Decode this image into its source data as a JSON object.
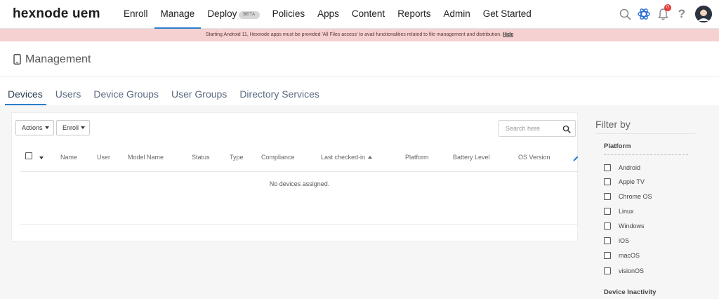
{
  "brand": {
    "logo_text": "hexnode uem"
  },
  "nav": {
    "items": [
      {
        "label": "Enroll"
      },
      {
        "label": "Manage",
        "active": true
      },
      {
        "label": "Deploy",
        "badge": "BETA"
      },
      {
        "label": "Policies"
      },
      {
        "label": "Apps"
      },
      {
        "label": "Content"
      },
      {
        "label": "Reports"
      },
      {
        "label": "Admin"
      },
      {
        "label": "Get Started"
      }
    ],
    "icons": [
      "search-icon",
      "integrations-icon",
      "notifications-icon",
      "help-icon",
      "user-avatar"
    ],
    "notification_count": "0",
    "help_label": "?"
  },
  "banner": {
    "message": "Starting Android 11, Hexnode apps must be provided  'All Files access'  to avail functionalities related to file management and distribution. ",
    "link": "Hide"
  },
  "page": {
    "title": "Management",
    "icon": "mobile-device-icon"
  },
  "tabs": [
    {
      "label": "Devices",
      "active": true
    },
    {
      "label": "Users"
    },
    {
      "label": "Device Groups"
    },
    {
      "label": "User Groups"
    },
    {
      "label": "Directory Services"
    }
  ],
  "toolbar": {
    "actions_label": "Actions",
    "enroll_label": "Enroll",
    "search_placeholder": "Search here"
  },
  "table": {
    "columns": [
      "Name",
      "User",
      "Model Name",
      "Status",
      "Type",
      "Compliance",
      "Last checked-in",
      "Platform",
      "Battery Level",
      "OS Version"
    ],
    "sorted_column": "Last checked-in",
    "sort_direction": "ascending",
    "empty_message": "No devices assigned."
  },
  "filter": {
    "title": "Filter by",
    "platform_heading": "Platform",
    "platforms": [
      "Android",
      "Apple TV",
      "Chrome OS",
      "Linux",
      "Windows",
      "iOS",
      "macOS",
      "visionOS"
    ],
    "inactivity_heading": "Device Inactivity"
  },
  "colors": {
    "accent": "#2a7fc9",
    "banner_bg": "#f5d1d1",
    "badge": "#e53935"
  }
}
